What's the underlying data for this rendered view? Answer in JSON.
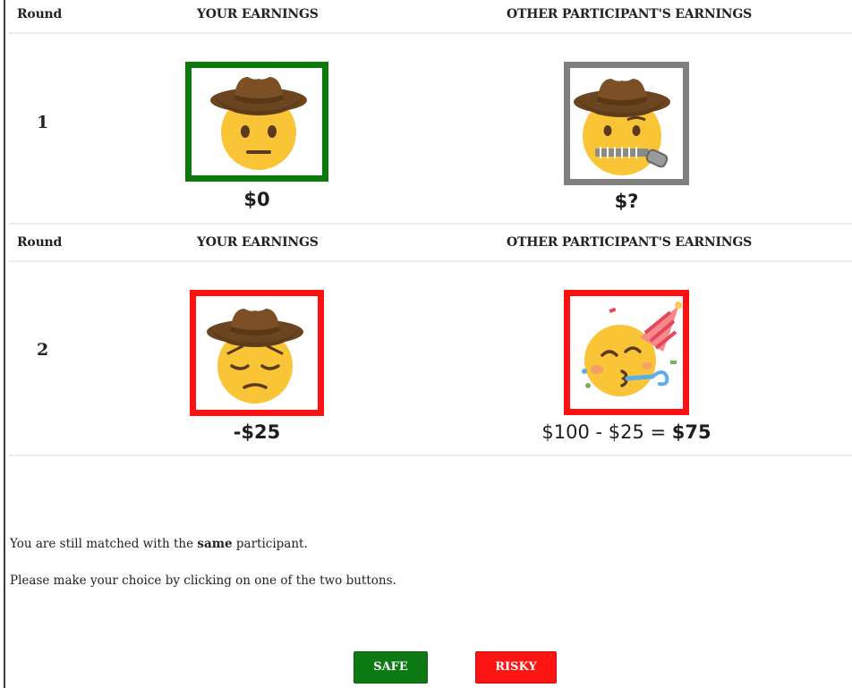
{
  "colors": {
    "win_border": "#0a7a0a",
    "loss_border": "#ff1010",
    "unknown_border": "#7f7f7f",
    "safe_button": "#0d7a14",
    "risky_button": "#ff1414"
  },
  "rounds": [
    {
      "header": {
        "round_label": "Round",
        "your_label": "YOUR EARNINGS",
        "other_label": "OTHER PARTICIPANT'S EARNINGS"
      },
      "number": "1",
      "your": {
        "emoji": "neutral-cowboy-face-icon",
        "amount": "$0"
      },
      "other": {
        "emoji": "zipper-mouth-cowboy-face-icon",
        "amount": "$?"
      }
    },
    {
      "header": {
        "round_label": "Round",
        "your_label": "YOUR EARNINGS",
        "other_label": "OTHER PARTICIPANT'S EARNINGS"
      },
      "number": "2",
      "your": {
        "emoji": "pensive-cowboy-face-icon",
        "amount": "-$25"
      },
      "other": {
        "emoji": "partying-face-icon",
        "amount_prefix": "$100 - $25 = ",
        "amount_total": "$75"
      }
    }
  ],
  "message": {
    "line1_before": "You are still matched with the ",
    "line1_emphasis": "same",
    "line1_after": " participant.",
    "line2": "Please make your choice by clicking on one of the two buttons."
  },
  "buttons": {
    "safe_label": "SAFE",
    "risky_label": "RISKY"
  }
}
